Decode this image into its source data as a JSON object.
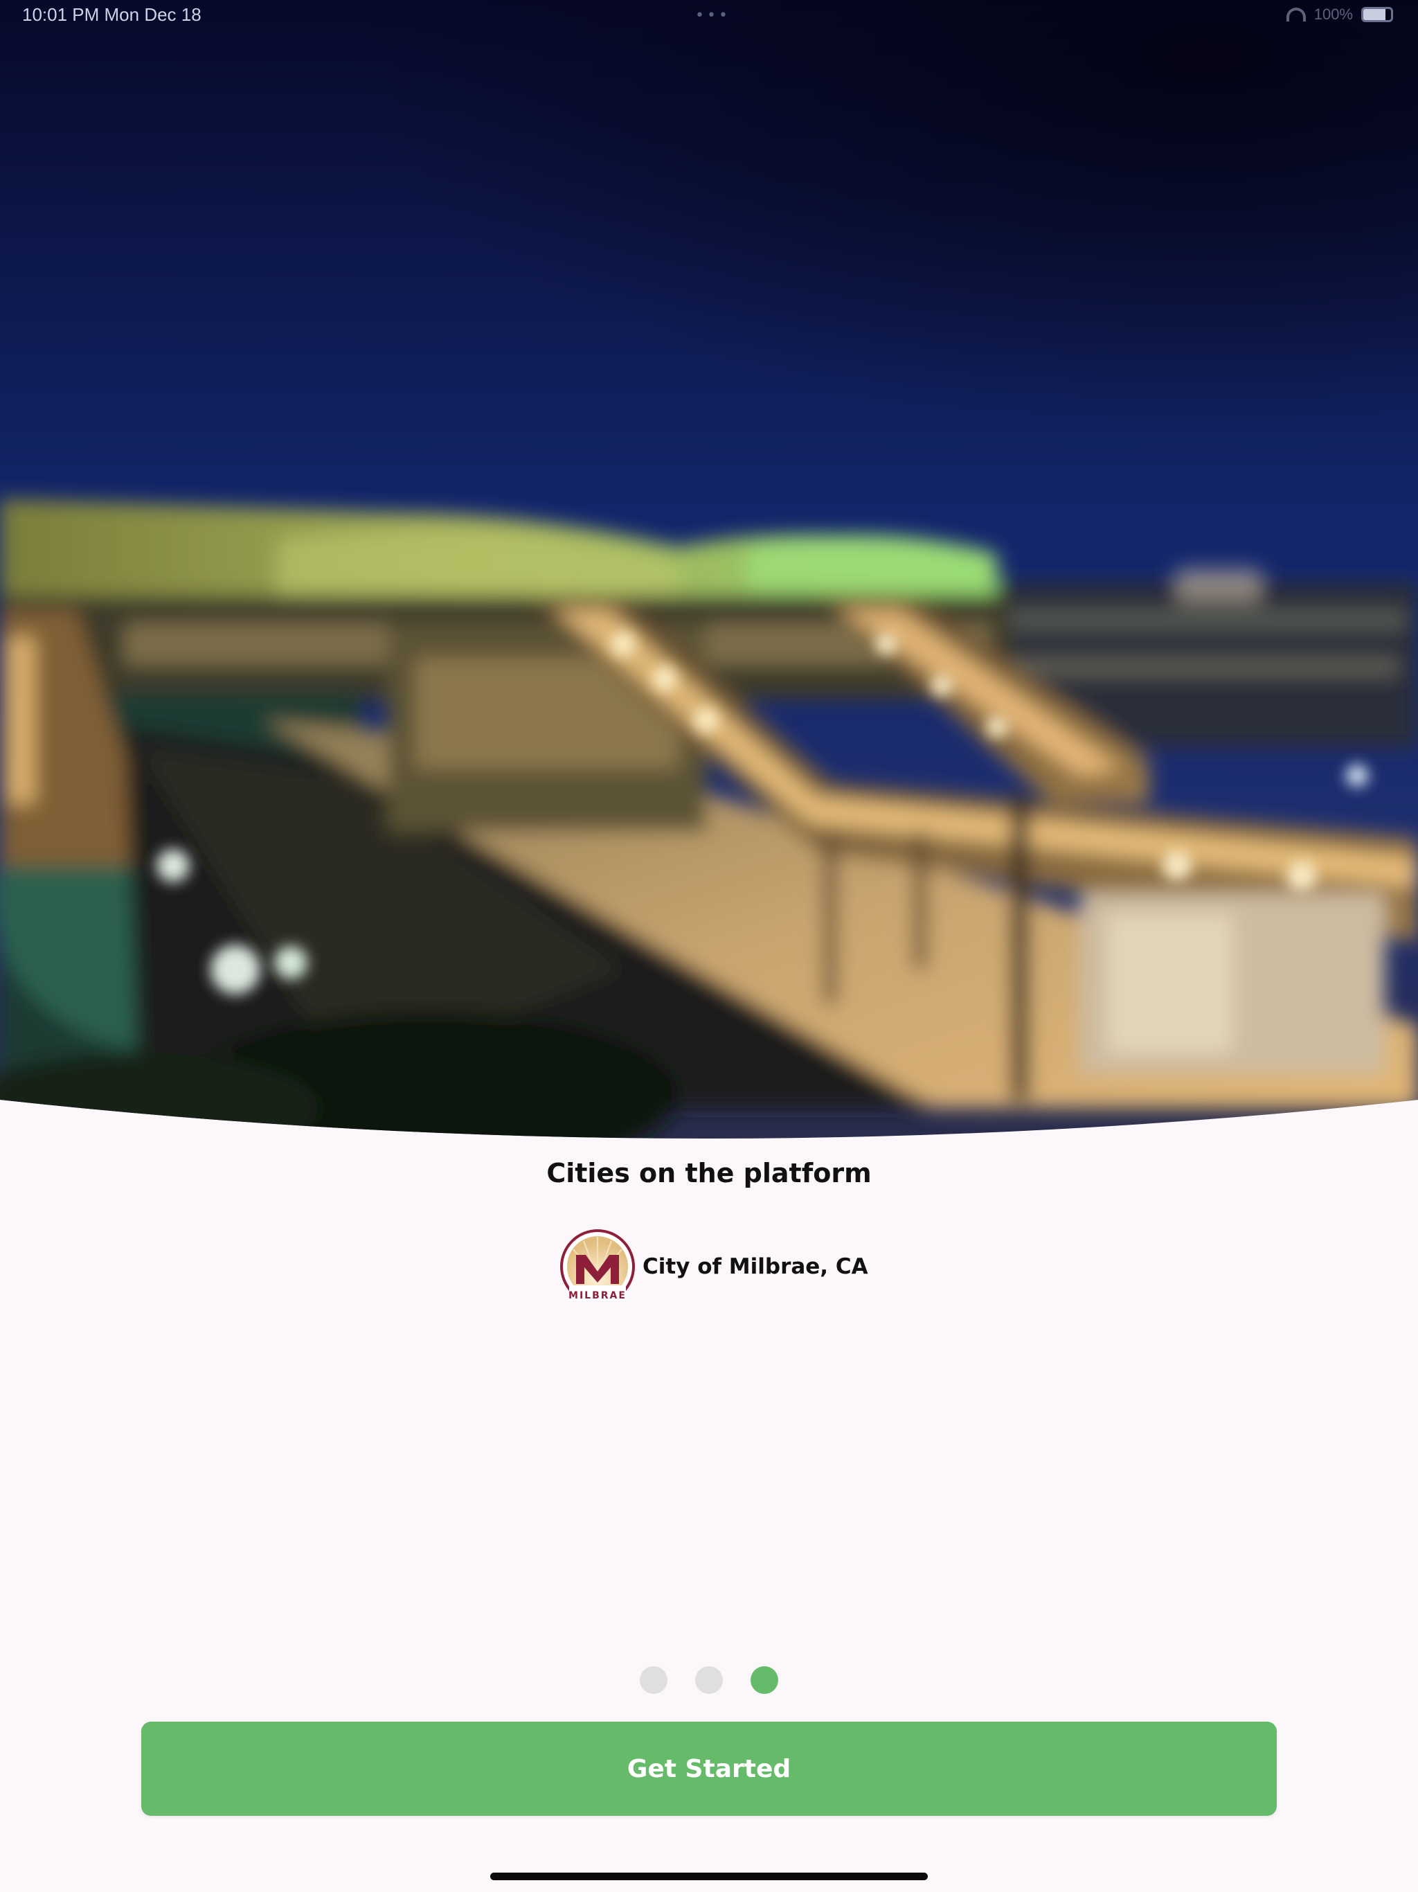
{
  "status_bar": {
    "time": "10:01 PM   Mon Dec 18",
    "center_indicator": "•••",
    "battery_percent": "100%",
    "icons": [
      "wifi-icon",
      "battery-icon"
    ]
  },
  "hero": {
    "image": "train-station-at-night"
  },
  "section": {
    "title": "Cities on the platform"
  },
  "cities": [
    {
      "name": "City of Milbrae, CA",
      "logo_letter": "M",
      "logo_text": "MILBRAE"
    }
  ],
  "pagination": {
    "total": 3,
    "active_index": 2
  },
  "actions": {
    "get_started_label": "Get Started"
  },
  "colors": {
    "accent": "#66bb6a",
    "background": "#fcf7fb",
    "dot_inactive": "#dfdfe0",
    "logo_maroon": "#8e1f3a",
    "logo_gold": "#e7c78e"
  }
}
